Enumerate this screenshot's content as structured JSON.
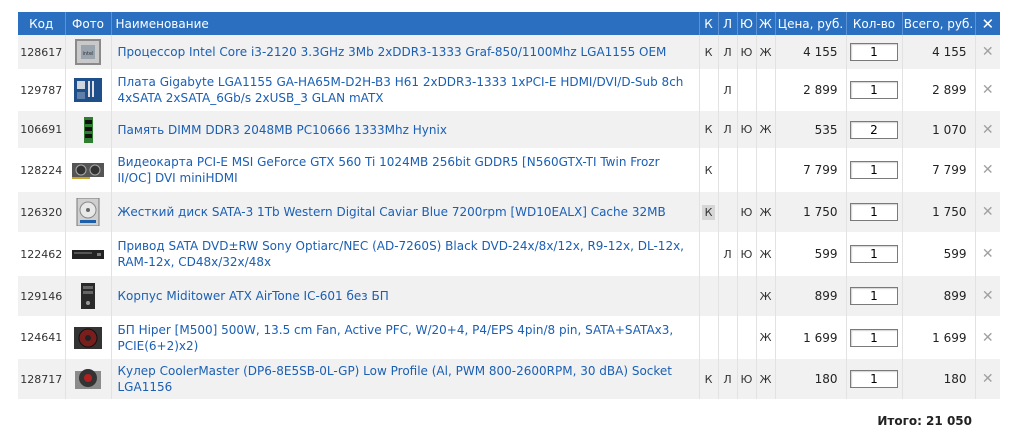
{
  "header": {
    "code": "Код",
    "photo": "Фото",
    "name": "Наименование",
    "flag_k": "К",
    "flag_l": "Л",
    "flag_yu": "Ю",
    "flag_zh": "Ж",
    "price": "Цена, руб.",
    "qty": "Кол-во",
    "total": "Всего, руб.",
    "clear_glyph": "✕"
  },
  "items": [
    {
      "code": "128617",
      "icon": "cpu-icon",
      "name": "Процессор Intel Core i3-2120 3.3GHz 3Mb 2xDDR3-1333 Graf-850/1100Mhz LGA1155 OEM",
      "k": "К",
      "l": "Л",
      "yu": "Ю",
      "zh": "Ж",
      "k_hl": false,
      "price": "4 155",
      "qty": "1",
      "total": "4 155",
      "h": 34
    },
    {
      "code": "129787",
      "icon": "motherboard-icon",
      "name": "Плата Gigabyte LGA1155 GA-HA65M-D2H-B3 H61 2xDDR3-1333 1xPCI-E HDMI/DVI/D-Sub 8ch 4xSATA 2xSATA_6Gb/s 2xUSB_3 GLAN mATX",
      "k": "",
      "l": "Л",
      "yu": "",
      "zh": "",
      "k_hl": false,
      "price": "2 899",
      "qty": "1",
      "total": "2 899",
      "h": 42
    },
    {
      "code": "106691",
      "icon": "memory-icon",
      "name": "Память DIMM DDR3 2048MB PC10666 1333Mhz Hynix",
      "k": "К",
      "l": "Л",
      "yu": "Ю",
      "zh": "Ж",
      "k_hl": false,
      "price": "535",
      "qty": "2",
      "total": "1 070",
      "h": 37
    },
    {
      "code": "128224",
      "icon": "graphics-card-icon",
      "name": "Видеокарта PCI-E MSI GeForce GTX 560 Ti 1024MB 256bit GDDR5 [N560GTX-TI Twin Frozr II/OC] DVI miniHDMI",
      "k": "К",
      "l": "",
      "yu": "",
      "zh": "",
      "k_hl": false,
      "price": "7 799",
      "qty": "1",
      "total": "7 799",
      "h": 44
    },
    {
      "code": "126320",
      "icon": "hard-drive-icon",
      "name": "Жесткий диск SATA-3 1Tb Western Digital Caviar Blue 7200rpm [WD10EALX] Cache 32MB",
      "k": "К",
      "l": "",
      "yu": "Ю",
      "zh": "Ж",
      "k_hl": true,
      "price": "1 750",
      "qty": "1",
      "total": "1 750",
      "h": 40
    },
    {
      "code": "122462",
      "icon": "optical-drive-icon",
      "name": "Привод SATA DVD±RW Sony Optiarc/NEC (AD-7260S) Black DVD-24x/8x/12x, R9-12x, DL-12x, RAM-12x, CD48x/32x/48x",
      "k": "",
      "l": "Л",
      "yu": "Ю",
      "zh": "Ж",
      "k_hl": false,
      "price": "599",
      "qty": "1",
      "total": "599",
      "h": 44
    },
    {
      "code": "129146",
      "icon": "pc-case-icon",
      "name": "Корпус Miditower ATX AirTone IC-601 без БП",
      "k": "",
      "l": "",
      "yu": "",
      "zh": "Ж",
      "k_hl": false,
      "price": "899",
      "qty": "1",
      "total": "899",
      "h": 40
    },
    {
      "code": "124641",
      "icon": "power-supply-icon",
      "name": "БП Hiper [M500] 500W, 13.5 cm Fan, Active PFC, W/20+4, P4/EPS 4pin/8 pin, SATA+SATAx3, PCIE(6+2)x2)",
      "k": "",
      "l": "",
      "yu": "",
      "zh": "Ж",
      "k_hl": false,
      "price": "1 699",
      "qty": "1",
      "total": "1 699",
      "h": 43
    },
    {
      "code": "128717",
      "icon": "cpu-cooler-icon",
      "name": "Кулер CoolerMaster (DP6-8E5SB-0L-GP) Low Profile (Al, PWM 800-2600RPM, 30 dBA) Socket LGA1156",
      "k": "К",
      "l": "Л",
      "yu": "Ю",
      "zh": "Ж",
      "k_hl": false,
      "price": "180",
      "qty": "1",
      "total": "180",
      "h": 40
    }
  ],
  "remove_glyph": "✕",
  "footer": {
    "total_text": "Итого: 21 050"
  }
}
